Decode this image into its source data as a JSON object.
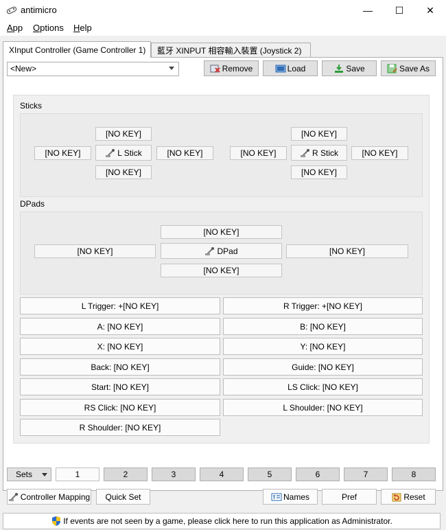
{
  "window": {
    "title": "antimicro",
    "minimize_glyph": "—",
    "maximize_glyph": "☐",
    "close_glyph": "✕"
  },
  "menu": {
    "app_first": "A",
    "app_rest": "pp",
    "options_first": "O",
    "options_rest": "ptions",
    "help_first": "H",
    "help_rest": "elp"
  },
  "tabs": [
    {
      "label": "XInput Controller (Game Controller 1)"
    },
    {
      "label": "藍牙 XINPUT 相容輸入裝置 (Joystick 2)"
    }
  ],
  "profile": {
    "selected": "<New>"
  },
  "toolbar": {
    "remove": "Remove",
    "load": "Load",
    "save": "Save",
    "save_as": "Save As"
  },
  "sticks": {
    "title": "Sticks",
    "left": {
      "up": "[NO KEY]",
      "left": "[NO KEY]",
      "center": "L Stick",
      "right": "[NO KEY]",
      "down": "[NO KEY]"
    },
    "right": {
      "up": "[NO KEY]",
      "left": "[NO KEY]",
      "center": "R Stick",
      "right": "[NO KEY]",
      "down": "[NO KEY]"
    }
  },
  "dpads": {
    "title": "DPads",
    "up": "[NO KEY]",
    "left": "[NO KEY]",
    "center": "DPad",
    "right": "[NO KEY]",
    "down": "[NO KEY]"
  },
  "buttons": {
    "l_trigger": "L Trigger: +[NO KEY]",
    "r_trigger": "R Trigger: +[NO KEY]",
    "a": "A: [NO KEY]",
    "b": "B: [NO KEY]",
    "x": "X: [NO KEY]",
    "y": "Y: [NO KEY]",
    "back": "Back: [NO KEY]",
    "guide": "Guide: [NO KEY]",
    "start": "Start: [NO KEY]",
    "ls_click": "LS Click: [NO KEY]",
    "rs_click": "RS Click: [NO KEY]",
    "l_shoulder": "L Shoulder: [NO KEY]",
    "r_shoulder": "R Shoulder: [NO KEY]"
  },
  "sets": {
    "label": "Sets",
    "numbers": [
      "1",
      "2",
      "3",
      "4",
      "5",
      "6",
      "7",
      "8"
    ],
    "active": "1"
  },
  "bottom": {
    "controller_mapping": "Controller Mapping",
    "quick_set": "Quick Set",
    "names": "Names",
    "pref": "Pref",
    "reset": "Reset"
  },
  "status": {
    "text": "If events are not seen by a game, please click here to run this application as Administrator."
  },
  "colors": {
    "accent": "#0078d7",
    "remove_icon": "#d0302f",
    "load_icon": "#2f6db5",
    "save_icon": "#2e9e3a",
    "shield_blue": "#2a6ad1",
    "shield_yellow": "#f0c419"
  },
  "icons": {
    "app": "gamepad-icon",
    "remove": "remove-icon",
    "load": "folder-icon",
    "save": "save-icon",
    "save_as": "save-as-icon",
    "stick": "joystick-icon",
    "names": "names-icon",
    "reset": "reset-icon",
    "admin": "shield-icon"
  }
}
